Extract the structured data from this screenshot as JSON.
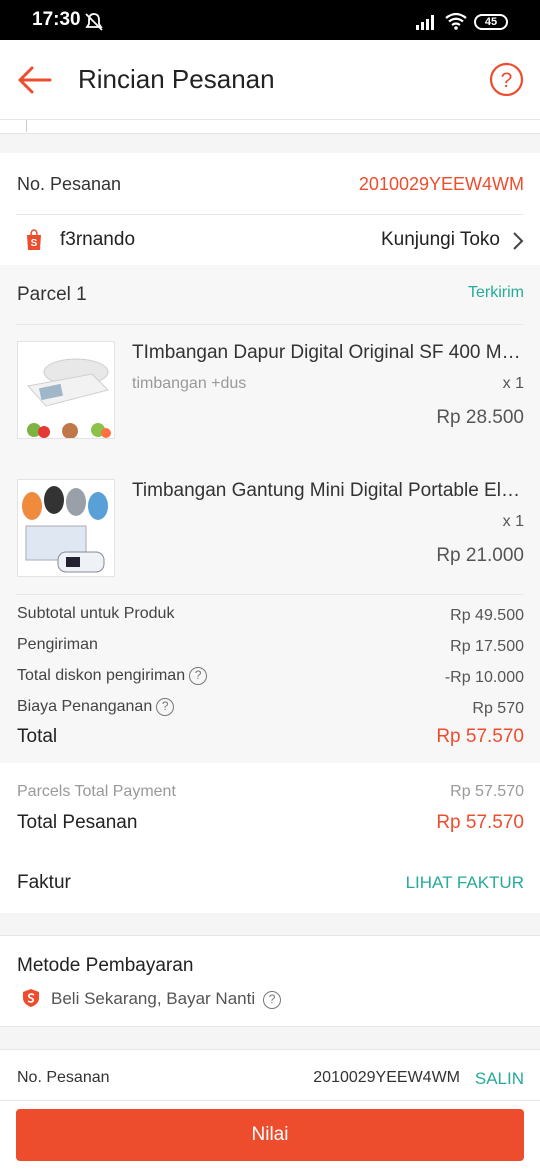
{
  "status_bar": {
    "time": "17:30",
    "battery": "45"
  },
  "header": {
    "title": "Rincian Pesanan"
  },
  "order": {
    "no_label": "No. Pesanan",
    "no_value": "2010029YEEW4WM",
    "shop_name": "f3rnando",
    "visit_shop": "Kunjungi Toko"
  },
  "parcel": {
    "title": "Parcel 1",
    "status": "Terkirim",
    "items": [
      {
        "name": "TImbangan Dapur Digital Original SF 400 Mu...",
        "variant": "timbangan +dus",
        "qty": "x 1",
        "price": "Rp 28.500"
      },
      {
        "name": "Timbangan Gantung Mini Digital Portable Ele...",
        "variant": "",
        "qty": "x 1",
        "price": "Rp 21.000"
      }
    ],
    "summary": [
      {
        "label": "Subtotal untuk Produk",
        "value": "Rp 49.500"
      },
      {
        "label": "Pengiriman",
        "value": "Rp 17.500"
      },
      {
        "label": "Total diskon pengiriman",
        "value": "-Rp 10.000"
      },
      {
        "label": "Biaya Penanganan",
        "value": "Rp 570"
      }
    ],
    "total_label": "Total",
    "total_value": "Rp 57.570"
  },
  "payment_totals": {
    "parcels_label": "Parcels Total Payment",
    "parcels_value": "Rp 57.570",
    "total_label": "Total Pesanan",
    "total_value": "Rp 57.570"
  },
  "invoice": {
    "label": "Faktur",
    "action": "LIHAT FAKTUR"
  },
  "payment_method": {
    "title": "Metode Pembayaran",
    "method": "Beli Sekarang, Bayar Nanti"
  },
  "footer_order": {
    "label": "No. Pesanan",
    "value": "2010029YEEW4WM",
    "copy": "SALIN"
  },
  "actions": {
    "rate": "Nilai"
  },
  "colors": {
    "accent": "#ee4d2d",
    "teal": "#26aa99"
  }
}
